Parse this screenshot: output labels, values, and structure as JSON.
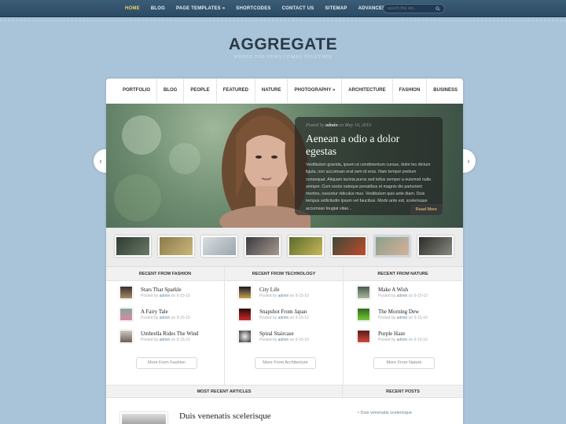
{
  "topnav": {
    "items": [
      "HOME",
      "BLOG",
      "PAGE TEMPLATES »",
      "SHORTCODES",
      "CONTACT US",
      "SITEMAP",
      "ADVANCED SEARCH"
    ],
    "search_placeholder": "search this site..."
  },
  "logo": {
    "title": "AGGREGATE",
    "tagline": "WHERE THE NEWS COMES TOGETHER"
  },
  "catnav": {
    "items": [
      "PORTFOLIO",
      "BLOG",
      "PEOPLE",
      "FEATURED",
      "NATURE",
      "PHOTOGRAPHY »",
      "ARCHITECTURE",
      "FASHION",
      "BUSINESS"
    ]
  },
  "slider": {
    "meta_prefix": "Posted by",
    "meta_author": "admin",
    "meta_suffix": "on May 10, 2010",
    "title": "Aenean a odio a dolor egestas",
    "excerpt": "Vestibulum gravida, ipsum ut condimentum cursus, dolor leo dictum ligula, non accumsan erat sem id eros. Nam tempor pretium consequat. Aliquam lacinia purus sed tellus semper a euismod nulla semper. Cum sociis natoque penatibus et magnis dis parturient montes, nascetur ridiculus mus. Vestibulum quis ante diam. Duis tempus sollicitudin ipsum vel faucibus. Morbi ante est, scelerisque accumsan feugiat vitae...",
    "read_more": "Read More"
  },
  "recent": [
    {
      "heading": "RECENT FROM FASHION",
      "posts": [
        {
          "title": "Stars That Sparkle",
          "by": "Posted by",
          "author": "admin",
          "date": "on 9-15-10"
        },
        {
          "title": "A Fairy Tale",
          "by": "Posted by",
          "author": "admin",
          "date": "on 9-15-10"
        },
        {
          "title": "Umbrella Rides The Wind",
          "by": "Posted by",
          "author": "admin",
          "date": "on 9-15-10"
        }
      ],
      "more": "More From Fashion"
    },
    {
      "heading": "RECENT FROM TECHNOLOGY",
      "posts": [
        {
          "title": "City Life",
          "by": "Posted by",
          "author": "admin",
          "date": "on 9-15-10"
        },
        {
          "title": "Snapshot From Japan",
          "by": "Posted by",
          "author": "admin",
          "date": "on 9-15-10"
        },
        {
          "title": "Spiral Staircase",
          "by": "Posted by",
          "author": "admin",
          "date": "on 9-15-10"
        }
      ],
      "more": "More From Architecture"
    },
    {
      "heading": "RECENT FROM NATURE",
      "posts": [
        {
          "title": "Make A Wish",
          "by": "Posted by",
          "author": "admin",
          "date": "on 9-15-10"
        },
        {
          "title": "The Morning Dew",
          "by": "Posted by",
          "author": "admin",
          "date": "on 9-15-10"
        },
        {
          "title": "Purple Haze",
          "by": "Posted by",
          "author": "admin",
          "date": "on 9-15-10"
        }
      ],
      "more": "More From Nature"
    }
  ],
  "bottom": {
    "most_recent_heading": "MOST RECENT ARTICLES",
    "recent_posts_heading": "RECENT POSTS",
    "article_title": "Duis venenatis scelerisque",
    "recent_post_item": "Duis venenatis scelerisque"
  },
  "colors": {
    "background": "#a9c4d9",
    "topbar": "#2c4a63",
    "active_nav": "#f2d266",
    "logo_accent": "#e8a22a"
  }
}
